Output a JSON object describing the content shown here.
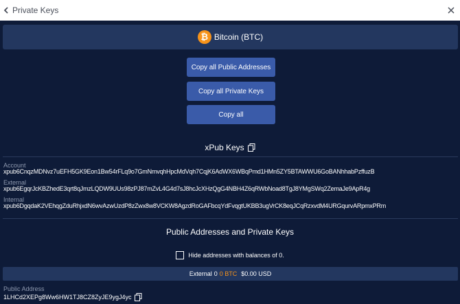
{
  "window": {
    "title": "Private Keys"
  },
  "coin": {
    "label": "Bitcoin (BTC)",
    "icon": "bitcoin-icon",
    "color": "#f7931a"
  },
  "actions": {
    "copy_public": "Copy all Public Addresses",
    "copy_private": "Copy all Private Keys",
    "copy_all": "Copy all"
  },
  "xpub": {
    "title": "xPub Keys",
    "account_label": "Account",
    "account_value": "xpub6CnqzMDNvz7uEFH5GK9Eon1Bw54rFLq9o7GmNmvqhHpcMdVqh7CqjK6AdWX6WBqPmd1HMn5ZY5BTAWWU6GoBANhhabPzffuzB",
    "external_label": "External",
    "external_value": "xpub6EgqrJcKBZhedE3qrt8qJmzLQDW9UUs98zPJ87mZvL4G4d7sJ8hcJcXHzQgG4NBH4Z6qRWbNoad8TgJ8YMgSWq2ZemaJe9ApR4g",
    "internal_label": "Internal",
    "internal_value": "xpub6DgqdaK2VEhqgZduRhjxdN6wvAzwUzdP8zZwx8w8VCKW8AgzdRoGAFbcqYdFvqgtUKBB3ugVrCK8eqJCqRzxvdM4URGqurvARpmxPRm"
  },
  "addresses": {
    "title": "Public Addresses and Private Keys",
    "hide_label": "Hide addresses with balances of 0.",
    "balance": {
      "label": "External",
      "count": "0",
      "btc": "0 BTC",
      "usd": "$0.00 USD"
    },
    "public_address_label": "Public Address",
    "public_address_value": "1LHCd2XEPg8Ww6HW1TJ8CZ8ZyJE9ygJ4yc"
  },
  "colors": {
    "background": "#0e1b38",
    "panel": "#23375f",
    "button": "#3a5ba9",
    "accent": "#f7931a"
  }
}
